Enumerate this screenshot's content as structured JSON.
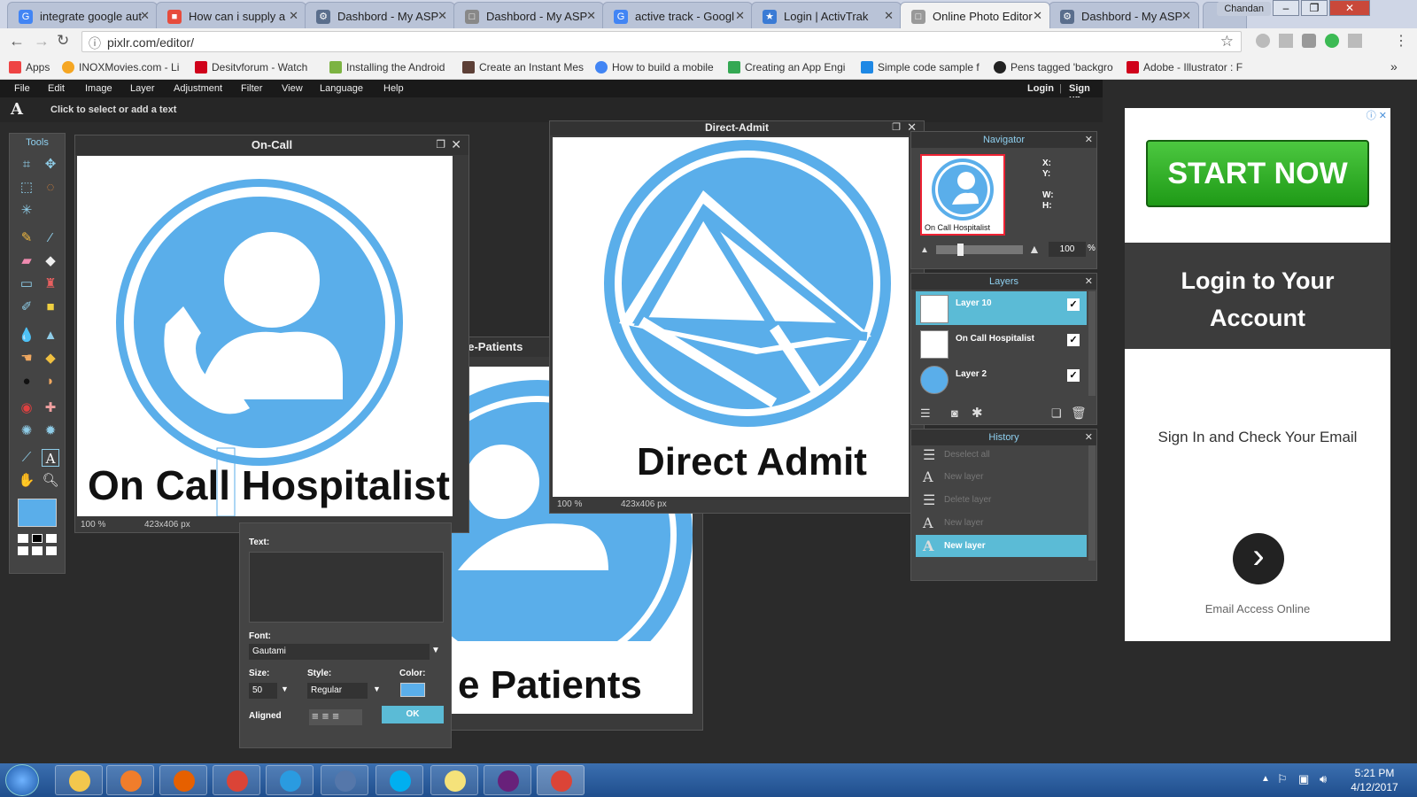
{
  "browser": {
    "tabs": [
      {
        "label": "integrate google aut",
        "favicon_color": "#4285f4",
        "favicon_letter": "G"
      },
      {
        "label": "How can i supply a",
        "favicon_color": "#e74c3c",
        "favicon_letter": "■"
      },
      {
        "label": "Dashbord - My ASP",
        "favicon_color": "#5a6e8c",
        "favicon_letter": "⚙"
      },
      {
        "label": "Dashbord - My ASP",
        "favicon_color": "#888888",
        "favicon_letter": "□"
      },
      {
        "label": "active track - Googl",
        "favicon_color": "#4285f4",
        "favicon_letter": "G"
      },
      {
        "label": "Login | ActivTrak",
        "favicon_color": "#3a7bd5",
        "favicon_letter": "★"
      },
      {
        "label": "Online Photo Editor",
        "favicon_color": "#999999",
        "favicon_letter": "□"
      },
      {
        "label": "Dashbord - My ASP",
        "favicon_color": "#5a6e8c",
        "favicon_letter": "⚙"
      }
    ],
    "user": "Chandan",
    "url": "pixlr.com/editor/",
    "bookmarks": [
      {
        "label": "Apps",
        "color": "#e44"
      },
      {
        "label": "INOXMovies.com - Li",
        "color": "#f5a623"
      },
      {
        "label": "Desitvforum - Watch",
        "color": "#d0021b"
      },
      {
        "label": "Installing the Android",
        "color": "#7cb342"
      },
      {
        "label": "Create an Instant Mes",
        "color": "#5d4037"
      },
      {
        "label": "How to build a mobile",
        "color": "#4285f4"
      },
      {
        "label": "Creating an App Engi",
        "color": "#34a853"
      },
      {
        "label": "Simple code sample f",
        "color": "#1e88e5"
      },
      {
        "label": "Pens tagged 'backgro",
        "color": "#222222"
      },
      {
        "label": "Adobe - Illustrator : F",
        "color": "#d0021b"
      }
    ]
  },
  "pixlr": {
    "menu": [
      "File",
      "Edit",
      "Image",
      "Layer",
      "Adjustment",
      "Filter",
      "View",
      "Language",
      "Help"
    ],
    "login": "Login",
    "signup": "Sign up",
    "text_hint": "Click to select or add a text",
    "tools_title": "Tools",
    "primary_color": "#5aaeea",
    "docs": {
      "oncall": {
        "title": "On-Call",
        "text": "On Call Hospitalist",
        "zoom": "100",
        "pct": "%",
        "size": "423x406 px"
      },
      "patients": {
        "title": "ve-Patients",
        "text": "e Patients"
      },
      "direct": {
        "title": "Direct-Admit",
        "text": "Direct Admit",
        "zoom": "100",
        "pct": "%",
        "size": "423x406 px"
      }
    },
    "navigator": {
      "title": "Navigator",
      "x_label": "X:",
      "y_label": "Y:",
      "w_label": "W:",
      "h_label": "H:",
      "thumb_caption": "On Call Hospitalist",
      "zoom": "100",
      "pct": "%"
    },
    "layers": {
      "title": "Layers",
      "items": [
        {
          "name": "Layer 10",
          "check": "✓"
        },
        {
          "name": "On Call Hospitalist",
          "check": "✓"
        },
        {
          "name": "Layer 2",
          "check": "✓"
        }
      ]
    },
    "history": {
      "title": "History",
      "items": [
        {
          "label": "Deselect all"
        },
        {
          "label": "New layer"
        },
        {
          "label": "Delete layer"
        },
        {
          "label": "New layer"
        },
        {
          "label": "New layer"
        }
      ]
    },
    "text_dialog": {
      "text_label": "Text:",
      "font_label": "Font:",
      "font_value": "Gautami",
      "size_label": "Size:",
      "size_value": "50",
      "style_label": "Style:",
      "style_value": "Regular",
      "color_label": "Color:",
      "aligned_label": "Aligned",
      "ok": "OK"
    }
  },
  "ad": {
    "cta": "START NOW",
    "heading_line1": "Login to Your",
    "heading_line2": "Account",
    "body": "Sign In and Check Your Email",
    "footer": "Email Access Online",
    "arrow": "›"
  },
  "taskbar": {
    "time": "5:21 PM",
    "date": "4/12/2017",
    "icons": [
      "file-explorer",
      "media-player",
      "firefox",
      "chrome",
      "internet-explorer",
      "network-app",
      "skype",
      "sticky-notes",
      "visual-studio",
      "chrome"
    ],
    "icon_colors": [
      "#f3c74d",
      "#f07d2b",
      "#e66000",
      "#db4437",
      "#2a9be0",
      "#5577aa",
      "#00aff0",
      "#f5e27a",
      "#68217a",
      "#db4437"
    ]
  }
}
